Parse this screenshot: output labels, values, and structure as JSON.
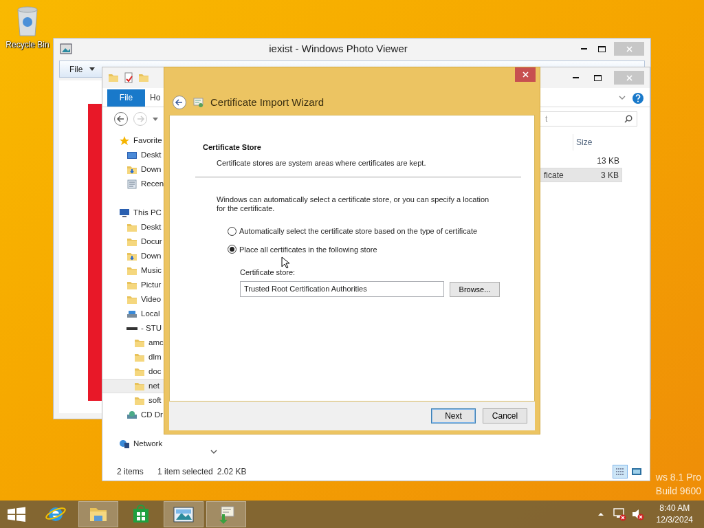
{
  "desktop_icons": [
    {
      "label": "Recycle Bin"
    }
  ],
  "photo_viewer": {
    "title": "iexist - Windows Photo Viewer",
    "menu": [
      "File"
    ]
  },
  "explorer": {
    "ribbon_tabs": [
      {
        "label": "File",
        "selected": true
      },
      {
        "label": "Ho",
        "selected": false
      }
    ],
    "search": {
      "placeholder": "t"
    },
    "nav": [
      {
        "label": "Favorite",
        "kind": "star",
        "selected": false,
        "children": [
          {
            "label": "Deskt",
            "kind": "desktop",
            "selected": false
          },
          {
            "label": "Down",
            "kind": "downloads",
            "selected": false
          },
          {
            "label": "Recen",
            "kind": "recent",
            "selected": false
          }
        ]
      },
      {
        "label": "This PC",
        "kind": "pc",
        "selected": false,
        "children": [
          {
            "label": "Deskt",
            "kind": "folder",
            "selected": false
          },
          {
            "label": "Docur",
            "kind": "folder",
            "selected": false
          },
          {
            "label": "Down",
            "kind": "downloads",
            "selected": false
          },
          {
            "label": "Music",
            "kind": "folder",
            "selected": false
          },
          {
            "label": "Pictur",
            "kind": "folder",
            "selected": false
          },
          {
            "label": "Video",
            "kind": "folder",
            "selected": false
          },
          {
            "label": "Local",
            "kind": "disk",
            "selected": false
          },
          {
            "label": "- STU",
            "kind": "drive",
            "selected": false,
            "children": [
              {
                "label": "amc",
                "kind": "folder",
                "selected": false
              },
              {
                "label": "dlm",
                "kind": "folder",
                "selected": false
              },
              {
                "label": "doc",
                "kind": "folder",
                "selected": false
              },
              {
                "label": "net",
                "kind": "folder",
                "selected": true
              },
              {
                "label": "soft",
                "kind": "folder",
                "selected": false
              }
            ]
          },
          {
            "label": "CD Dr",
            "kind": "cd",
            "selected": false
          }
        ]
      },
      {
        "label": "Network",
        "kind": "network",
        "selected": false
      }
    ],
    "columns": [
      "Size"
    ],
    "files": [
      {
        "size": "13 KB",
        "selected": false
      },
      {
        "name": "ficate",
        "size": "3 KB",
        "selected": true
      }
    ],
    "status": {
      "count": "2 items",
      "selection": "1 item selected",
      "size": "2.02 KB"
    }
  },
  "wizard": {
    "title": "Certificate Import Wizard",
    "section_title": "Certificate Store",
    "section_desc": "Certificate stores are system areas where certificates are kept.",
    "intro": "Windows can automatically select a certificate store, or you can specify a location for the certificate.",
    "options": [
      {
        "label": "Automatically select the certificate store based on the type of certificate",
        "selected": false
      },
      {
        "label": "Place all certificates in the following store",
        "selected": true
      }
    ],
    "store_label": "Certificate store:",
    "store_value": "Trusted Root Certification Authorities",
    "browse": "Browse...",
    "buttons": [
      {
        "label": "Next",
        "default": true
      },
      {
        "label": "Cancel",
        "default": false
      }
    ]
  },
  "watermark": {
    "edition": "ws 8.1 Pro",
    "build": "Build 9600"
  },
  "taskbar": {
    "apps": [
      {
        "kind": "ie",
        "open": false
      },
      {
        "kind": "explorer",
        "open": true
      },
      {
        "kind": "store",
        "open": false
      },
      {
        "kind": "photos",
        "open": true
      },
      {
        "kind": "certificate",
        "open": true
      }
    ],
    "clock": {
      "time": "8:40 AM",
      "date": "12/3/2024"
    }
  }
}
